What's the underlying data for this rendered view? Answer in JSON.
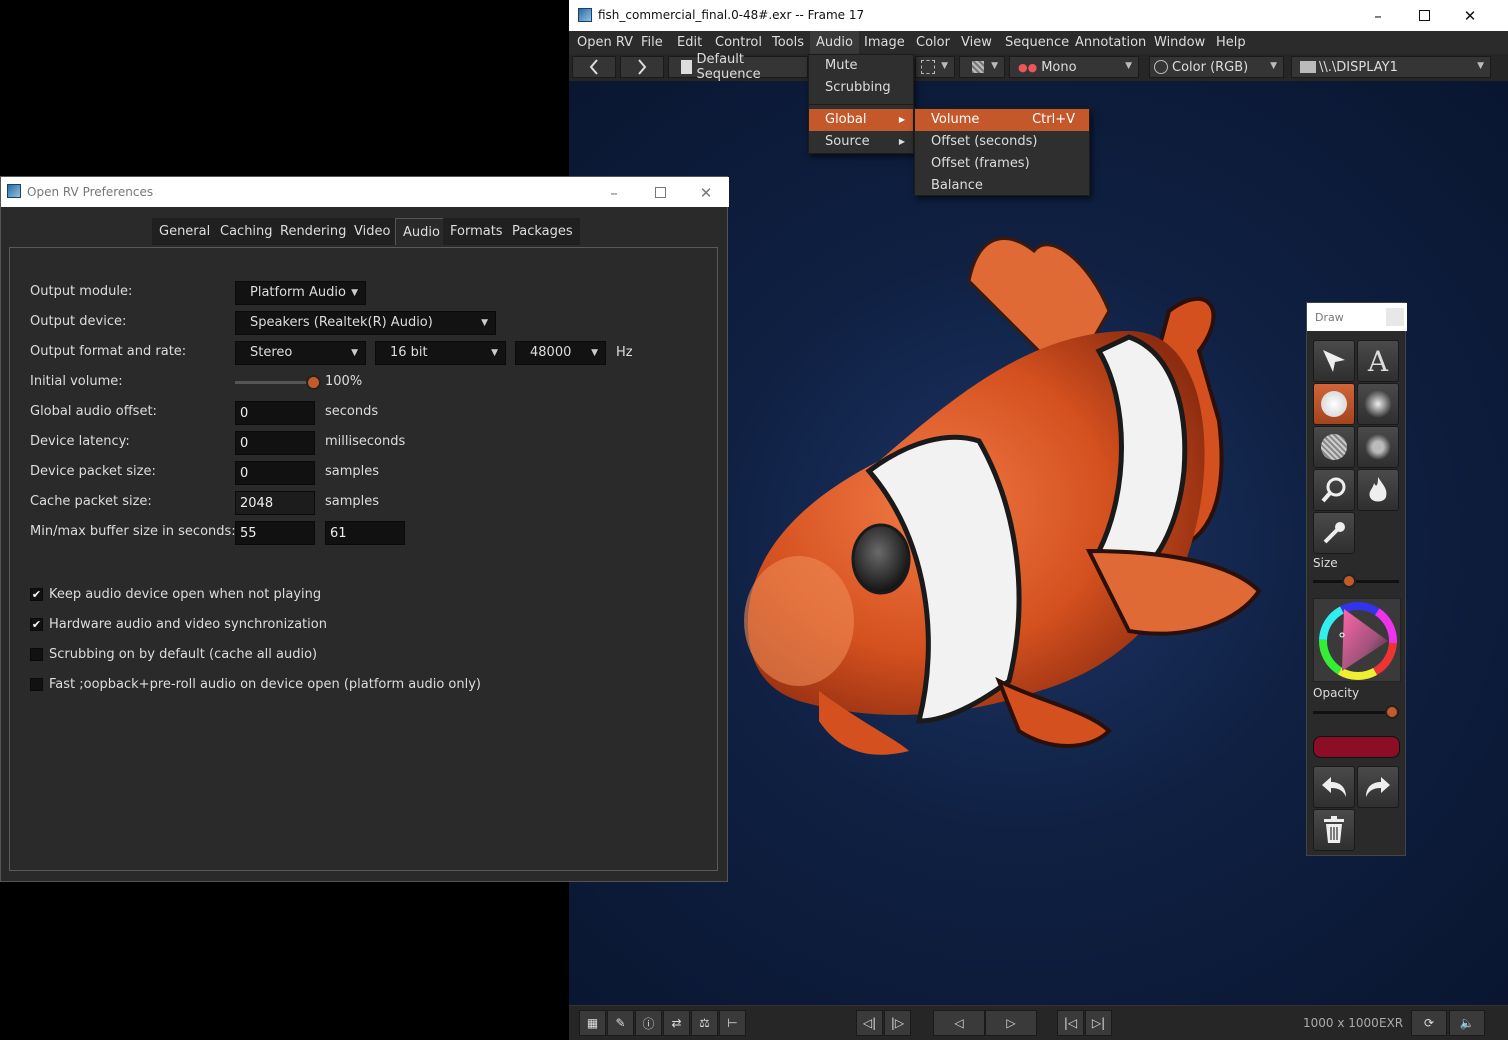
{
  "rv": {
    "title": "fish_commercial_final.0-48#.exr -- Frame 17",
    "menu": [
      "Open RV",
      "File",
      "Edit",
      "Control",
      "Tools",
      "Audio",
      "Image",
      "Color",
      "View",
      "Sequence",
      "Annotation",
      "Window",
      "Help"
    ],
    "toolbar": {
      "sequence": "Default Sequence",
      "stereo": "Mono",
      "color": "Color (RGB)",
      "display": "\\\\.\\DISPLAY1"
    },
    "audio_menu": {
      "items": [
        "Mute",
        "Scrubbing",
        "Global",
        "Source"
      ]
    },
    "global_submenu": {
      "items": [
        "Volume",
        "Offset (seconds)",
        "Offset (frames)",
        "Balance"
      ],
      "shortcut": "Ctrl+V"
    },
    "status": {
      "resolution": "1000 x 1000",
      "format": "EXR"
    },
    "accent_color": "#c4582a"
  },
  "draw": {
    "title": "Draw",
    "size_label": "Size",
    "opacity_label": "Opacity",
    "brush_color": "#8b0d26",
    "tools": [
      "select-icon",
      "text-icon",
      "circle-brush-icon",
      "soft-brush-icon",
      "hatched-brush-icon",
      "soft-dot-brush-icon",
      "magnifier-icon",
      "flame-icon",
      "eyedropper-icon"
    ]
  },
  "prefs": {
    "title": "Open RV Preferences",
    "tabs": [
      "General",
      "Caching",
      "Rendering",
      "Video",
      "Audio",
      "Formats",
      "Packages"
    ],
    "active_tab": "Audio",
    "labels": {
      "output_module": "Output module:",
      "output_device": "Output device:",
      "format_rate": "Output format and rate:",
      "initial_volume": "Initial volume:",
      "global_offset": "Global audio offset:",
      "device_latency": "Device latency:",
      "packet_size": "Device packet size:",
      "cache_packet": "Cache packet size:",
      "buffer_size": "Min/max buffer size in seconds:"
    },
    "values": {
      "output_module": "Platform Audio",
      "output_device": "Speakers (Realtek(R) Audio)",
      "format": "Stereo",
      "bits": "16 bit",
      "rate": "48000",
      "rate_unit": "Hz",
      "volume": "100%",
      "volume_fraction": 1.0,
      "global_offset": "0",
      "global_offset_unit": "seconds",
      "device_latency": "0",
      "device_latency_unit": "milliseconds",
      "packet_size": "0",
      "packet_size_unit": "samples",
      "cache_packet": "2048",
      "cache_packet_unit": "samples",
      "buffer_min": "55",
      "buffer_max": "61"
    },
    "checkboxes": [
      {
        "label": "Keep audio device open when not playing",
        "checked": true
      },
      {
        "label": "Hardware audio and video synchronization",
        "checked": true
      },
      {
        "label": "Scrubbing on by default (cache all audio)",
        "checked": false
      },
      {
        "label": "Fast ;oopback+pre-roll audio on device open (platform audio only)",
        "checked": false
      }
    ]
  }
}
